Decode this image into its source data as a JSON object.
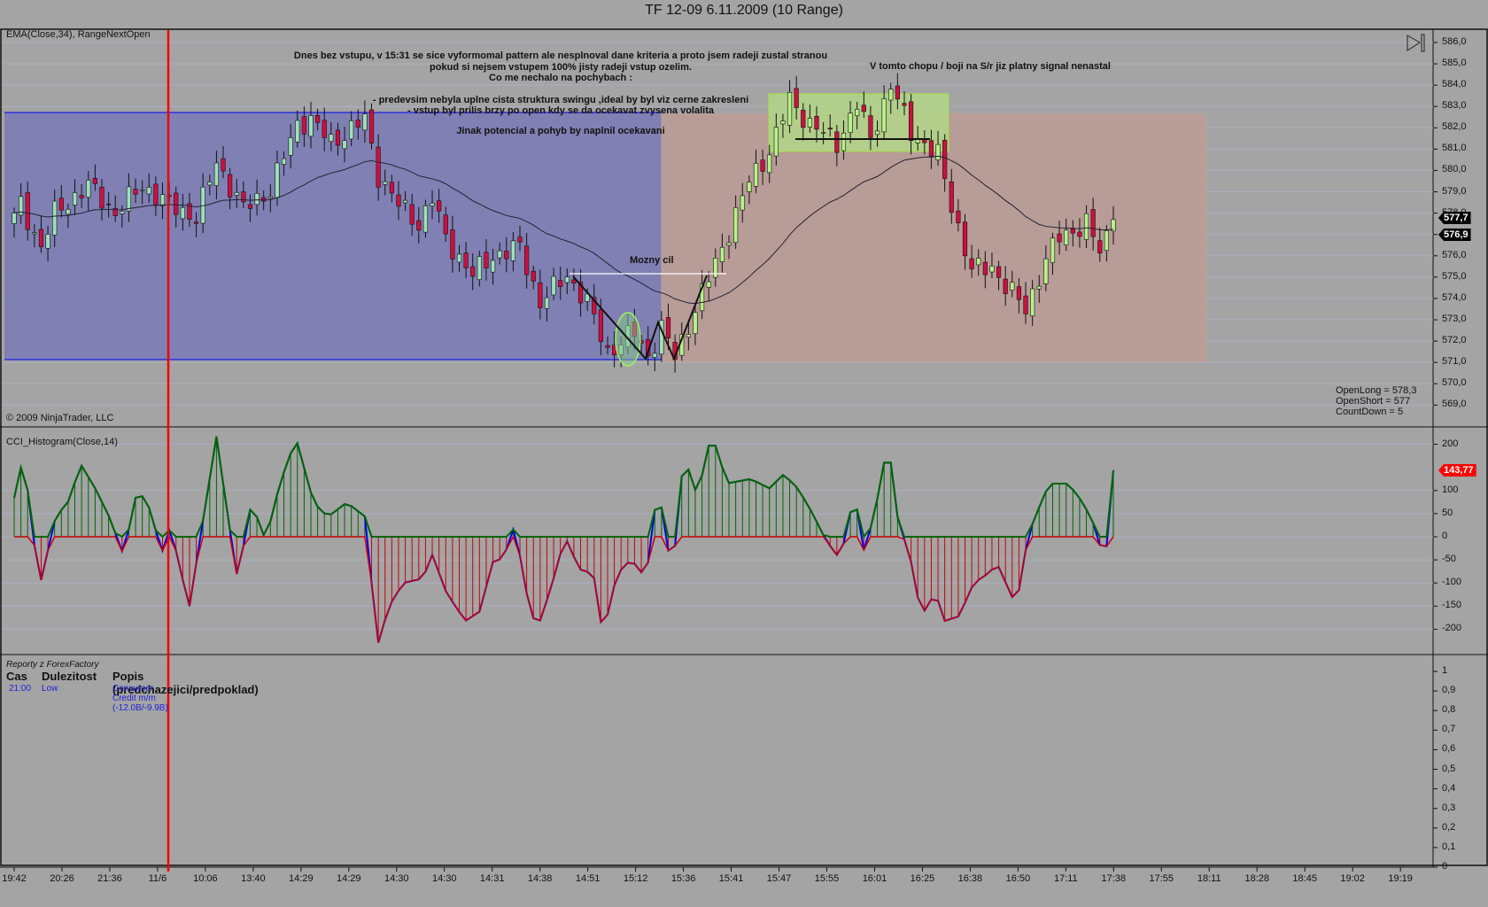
{
  "window": {
    "title": "TF 12-09  6.11.2009 (10 Range)"
  },
  "price_panel": {
    "label": "EMA(Close,34), RangeNextOpen",
    "copyright": "© 2009 NinjaTrader, LLC",
    "axis_ticks": [
      "586,0",
      "585,0",
      "584,0",
      "583,0",
      "582,0",
      "581,0",
      "580,0",
      "579,0",
      "578,0",
      "577,0",
      "576,0",
      "575,0",
      "574,0",
      "573,0",
      "572,0",
      "571,0",
      "570,0",
      "569,0"
    ],
    "last_price_tags": [
      {
        "text": "577,7",
        "color": "#000000"
      },
      {
        "text": "576,9",
        "color": "#000000"
      }
    ],
    "stats": [
      "OpenLong = 578,3",
      "OpenShort = 577",
      "CountDown = 5"
    ],
    "notes": {
      "main": [
        "Dnes bez vstupu, v 15:31 se sice vyformomal pattern ale nesplnoval dane kriteria a proto jsem radeji zustal stranou",
        "pokud si nejsem vstupem 100% jisty radeji vstup ozelim.",
        "Co me nechalo na pochybach :"
      ],
      "reasons": [
        "- predevsim nebyla uplne cista struktura swingu ,ideal by byl viz cerne zakresleni",
        "- vstup byl prilis brzy po open kdy se da ocekavat zvysena volalita"
      ],
      "conclusion": "Jinak potencial a pohyb by naplnil ocekavani",
      "target": "Mozny cil",
      "range_note": "V tomto chopu / boji na S/r jiz platny signal nenastal"
    }
  },
  "cci_panel": {
    "label": "CCI_Histogram(Close,14)",
    "axis_ticks": [
      "200",
      "100",
      "50",
      "0",
      "-50",
      "-100",
      "-150",
      "-200"
    ],
    "last_value_tag": {
      "text": "143,77",
      "color": "#ff0000"
    }
  },
  "news_panel": {
    "source": "Reporty z ForexFactory",
    "headers": [
      "Cas",
      "Dulezitost",
      "Popis (predchazejici/predpoklad)"
    ],
    "rows": [
      {
        "time": "21:00",
        "importance": "Low",
        "description": "Consumer Credit m/m (-12.0B/-9.9B)"
      }
    ],
    "axis_ticks": [
      "1",
      "0,9",
      "0,8",
      "0,7",
      "0,6",
      "0,5",
      "0,4",
      "0,3",
      "0,2",
      "0,1",
      "0"
    ]
  },
  "x_axis": {
    "labels": [
      "19:42",
      "20:26",
      "21:36",
      "11/6",
      "10:06",
      "13:40",
      "14:29",
      "14:29",
      "14:30",
      "14:30",
      "14:31",
      "14:38",
      "14:51",
      "15:12",
      "15:36",
      "15:41",
      "15:47",
      "15:55",
      "16:01",
      "16:25",
      "16:38",
      "16:50",
      "17:11",
      "17:38",
      "17:55",
      "18:11",
      "18:28",
      "18:45",
      "19:02",
      "19:19"
    ]
  },
  "colors": {
    "up": "#9fe0b8",
    "up_green": "#b8f08a",
    "down": "#cc1040",
    "ema": "#222233",
    "cci_line": "#0000ee",
    "cci_pos": "#006600",
    "cci_neg": "#cc0000",
    "blue_zone": "#8080b4",
    "salmon_zone": "#b89c98",
    "green_zone": "#b2d48a"
  },
  "chart_data": {
    "type": "candlestick",
    "bar_count": 164,
    "close_waypoints": [
      [
        0,
        577.8
      ],
      [
        1,
        578.4
      ],
      [
        4,
        576.4
      ],
      [
        6,
        578
      ],
      [
        11,
        579.3
      ],
      [
        15,
        578
      ],
      [
        19,
        579.3
      ],
      [
        23,
        578.4
      ],
      [
        27,
        577.8
      ],
      [
        30,
        580.4
      ],
      [
        34,
        578.2
      ],
      [
        38,
        579.1
      ],
      [
        42,
        582.2
      ],
      [
        44,
        582.4
      ],
      [
        47,
        581.3
      ],
      [
        52,
        582.4
      ],
      [
        54,
        579.8
      ],
      [
        57,
        578.4
      ],
      [
        60,
        577.5
      ],
      [
        62,
        578.7
      ],
      [
        64,
        576.8
      ],
      [
        68,
        575.1
      ],
      [
        71,
        576
      ],
      [
        75,
        576.4
      ],
      [
        78,
        573.8
      ],
      [
        82,
        575.1
      ],
      [
        85,
        573.8
      ],
      [
        88,
        571.5
      ],
      [
        92,
        572.4
      ],
      [
        94,
        571.3
      ],
      [
        96,
        572.6
      ],
      [
        98,
        571.3
      ],
      [
        101,
        573.5
      ],
      [
        105,
        576.4
      ],
      [
        109,
        579.5
      ],
      [
        112,
        580.9
      ],
      [
        115,
        583.3
      ],
      [
        118,
        582.2
      ],
      [
        122,
        581.3
      ],
      [
        125,
        583.1
      ],
      [
        127,
        581.5
      ],
      [
        130,
        584
      ],
      [
        133,
        581.8
      ],
      [
        137,
        580.7
      ],
      [
        139,
        578.4
      ],
      [
        142,
        575.3
      ],
      [
        145,
        575.5
      ],
      [
        147,
        574.6
      ],
      [
        150,
        573.5
      ],
      [
        153,
        575.8
      ],
      [
        155,
        576.9
      ],
      [
        159,
        577.5
      ],
      [
        161,
        576.2
      ],
      [
        163,
        577.7
      ]
    ],
    "ema_period": 34,
    "cci_waypoints": [
      [
        0,
        84
      ],
      [
        1.4,
        176
      ],
      [
        2.8,
        0
      ],
      [
        3.9,
        -100
      ],
      [
        6.3,
        53
      ],
      [
        7.7,
        63
      ],
      [
        9.9,
        156
      ],
      [
        12,
        105
      ],
      [
        14.1,
        43
      ],
      [
        16.2,
        -39
      ],
      [
        18.3,
        105
      ],
      [
        20.4,
        53
      ],
      [
        21.8,
        -39
      ],
      [
        23.2,
        23
      ],
      [
        24.6,
        -70
      ],
      [
        26,
        -150
      ],
      [
        28.2,
        53
      ],
      [
        30,
        217
      ],
      [
        31.7,
        43
      ],
      [
        33.1,
        -90
      ],
      [
        35.2,
        74
      ],
      [
        37.3,
        -8
      ],
      [
        39.4,
        115
      ],
      [
        41.8,
        213
      ],
      [
        44.4,
        74
      ],
      [
        46.5,
        43
      ],
      [
        49.3,
        74
      ],
      [
        52.1,
        43
      ],
      [
        52.8,
        -70
      ],
      [
        53.9,
        -234
      ],
      [
        55.6,
        -150
      ],
      [
        57.7,
        -100
      ],
      [
        60.6,
        -90
      ],
      [
        62,
        -39
      ],
      [
        64.1,
        -121
      ],
      [
        66.9,
        -182
      ],
      [
        69,
        -162
      ],
      [
        71.1,
        -49
      ],
      [
        72.5,
        -49
      ],
      [
        74.4,
        33
      ],
      [
        75.4,
        -90
      ],
      [
        77.5,
        -203
      ],
      [
        79.6,
        -111
      ],
      [
        81.7,
        0
      ],
      [
        83.8,
        -70
      ],
      [
        85.9,
        -80
      ],
      [
        87.3,
        -213
      ],
      [
        89.4,
        -80
      ],
      [
        91.5,
        -49
      ],
      [
        93.7,
        -90
      ],
      [
        95.5,
        115
      ],
      [
        96.5,
        12
      ],
      [
        97.6,
        -80
      ],
      [
        99.3,
        176
      ],
      [
        101.4,
        84
      ],
      [
        102.8,
        197
      ],
      [
        104.2,
        197
      ],
      [
        105.6,
        115
      ],
      [
        109.2,
        125
      ],
      [
        112,
        105
      ],
      [
        114.1,
        135
      ],
      [
        116.2,
        105
      ],
      [
        118.3,
        53
      ],
      [
        120.4,
        -8
      ],
      [
        122.5,
        -49
      ],
      [
        124.6,
        94
      ],
      [
        126,
        -29
      ],
      [
        127.5,
        43
      ],
      [
        129.6,
        207
      ],
      [
        131,
        43
      ],
      [
        133.1,
        -59
      ],
      [
        134.5,
        -172
      ],
      [
        136.6,
        -121
      ],
      [
        138,
        -182
      ],
      [
        140.1,
        -172
      ],
      [
        142.3,
        -100
      ],
      [
        144.4,
        -80
      ],
      [
        145.8,
        -59
      ],
      [
        148.6,
        -150
      ],
      [
        150,
        -29
      ],
      [
        151.1,
        33
      ],
      [
        153.5,
        115
      ],
      [
        156.3,
        115
      ],
      [
        158.5,
        74
      ],
      [
        160.6,
        12
      ],
      [
        161.7,
        -70
      ],
      [
        163,
        143.77
      ]
    ],
    "price_range": [
      569,
      586
    ],
    "cci_range": [
      -200,
      200
    ]
  }
}
